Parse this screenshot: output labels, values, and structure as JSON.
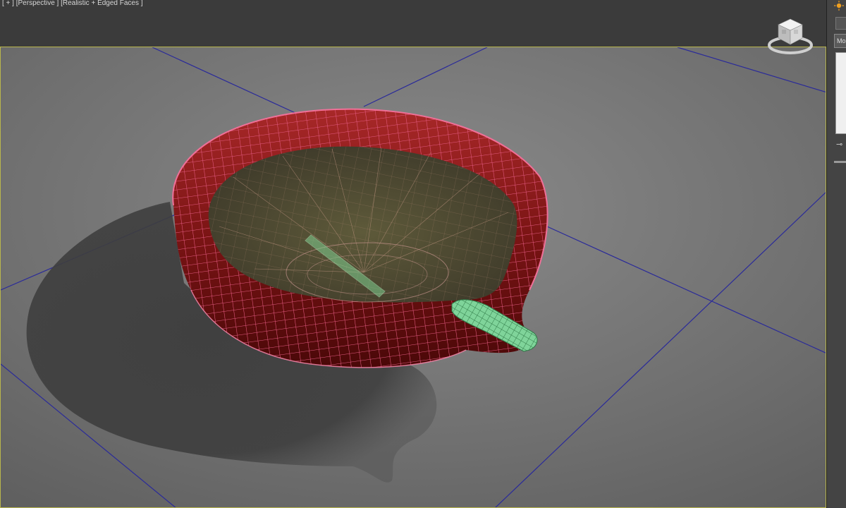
{
  "viewport": {
    "label_plus": "[ + ]",
    "label_view": "[Perspective ]",
    "label_shading": "[Realistic + Edged Faces ]"
  },
  "command_panel": {
    "modifier_dropdown_text": "Mo"
  },
  "colors": {
    "viewport_border": "#b9b64c",
    "grid_line": "#2a2a9a",
    "bowl_wireframe": "#e0547a",
    "wick_wireframe": "#6fc58a"
  }
}
